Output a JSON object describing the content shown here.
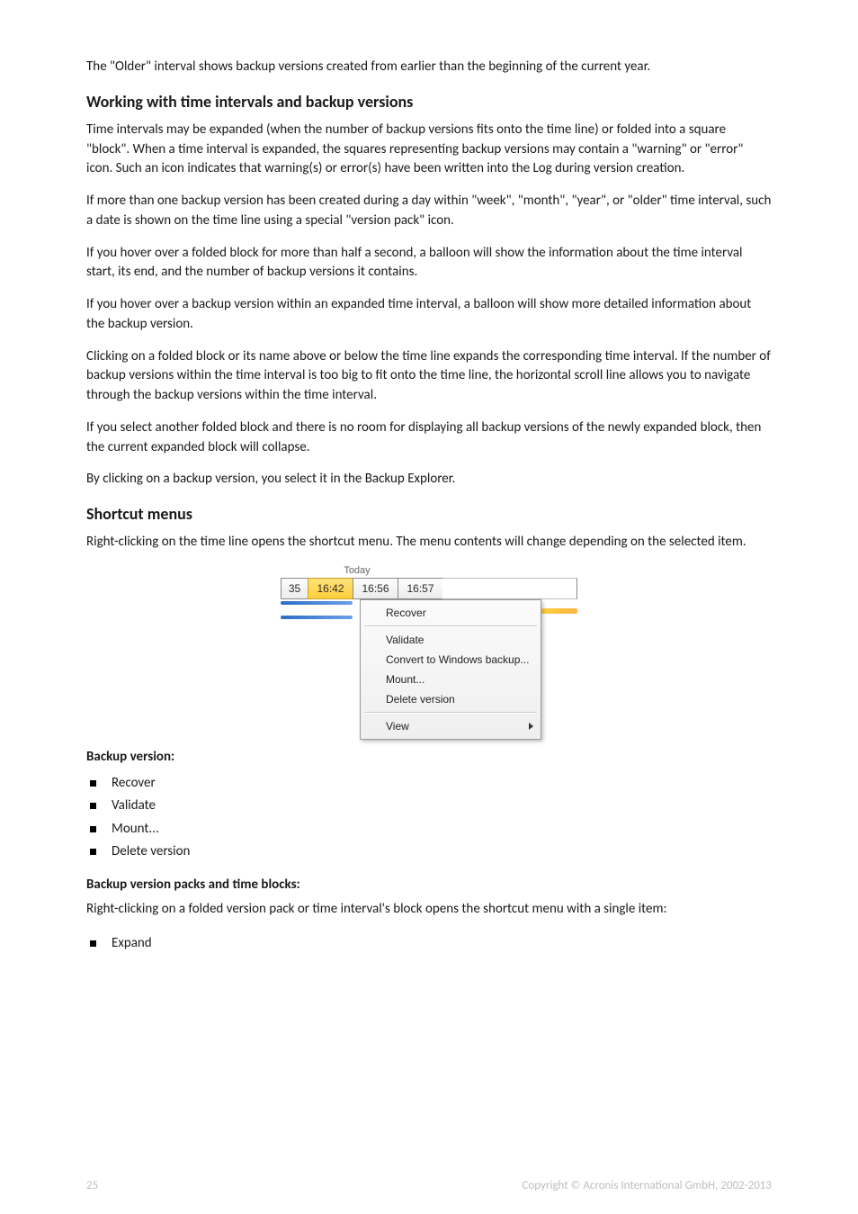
{
  "intro": "The \"Older\" interval shows backup versions created from earlier than the beginning of the current year.",
  "section1": {
    "heading": "Working with time intervals and backup versions",
    "p1": "Time intervals may be expanded (when the number of backup versions fits onto the time line) or folded into a square \"block\". When a time interval is expanded, the squares representing backup versions may contain a \"warning\" or \"error\" icon. Such an icon indicates that warning(s) or error(s) have been written into the Log during version creation.",
    "p2": "If more than one backup version has been created during a day within \"week\", \"month\", \"year\", or \"older\" time interval, such a date is shown on the time line using a special \"version pack\" icon.",
    "p3": "If you hover over a folded block for more than half a second, a balloon will show the information about the time interval start, its end, and the number of backup versions it contains.",
    "p4": "If you hover over a backup version within an expanded time interval, a balloon will show more detailed information about the backup version.",
    "p5": "Clicking on a folded block or its name above or below the time line expands the corresponding time interval. If the number of backup versions within the time interval is too big to fit onto the time line, the horizontal scroll line allows you to navigate through the backup versions within the time interval.",
    "p6": "If you select another folded block and there is no room for displaying all backup versions of the newly expanded block, then the current expanded block will collapse.",
    "p7": "By clicking on a backup version, you select it in the Backup Explorer."
  },
  "section2": {
    "heading": "Shortcut menus",
    "p1": "Right-clicking on the time line opens the shortcut menu. The menu contents will change depending on the selected item."
  },
  "screenshot": {
    "today_label": "Today",
    "timeline": {
      "c0": "35",
      "sel": "16:42",
      "c2": "16:56",
      "c3": "16:57"
    },
    "menu": {
      "recover": "Recover",
      "validate": "Validate",
      "convert": "Convert to Windows backup...",
      "mount": "Mount...",
      "delete": "Delete version",
      "view": "View"
    }
  },
  "lists": {
    "bv_heading": "Backup version:",
    "bv_items": [
      "Recover",
      "Validate",
      "Mount...",
      "Delete version"
    ],
    "packs_heading": "Backup version packs and time blocks:",
    "packs_p": "Right-clicking on a folded version pack or time interval's block opens the shortcut menu with a single item:",
    "packs_items": [
      "Expand"
    ]
  },
  "footer": {
    "page": "25",
    "copyright": "Copyright © Acronis International GmbH, 2002-2013"
  }
}
